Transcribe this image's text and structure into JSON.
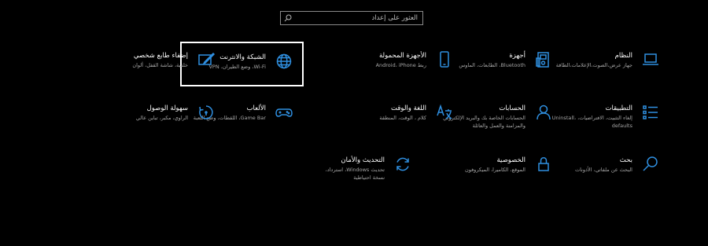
{
  "search": {
    "placeholder": "العثور على إعداد"
  },
  "tiles": [
    {
      "title": "النظام",
      "desc": "جهاز عرض،الصوت،الإعلامات،الطاقة",
      "icon": "laptop-icon"
    },
    {
      "title": "أجهزة",
      "desc": "Bluetooth، الطابعات، الماوس",
      "icon": "devices-icon"
    },
    {
      "title": "الأجهزة المحمولة",
      "desc": "ربط Android، iPhone",
      "icon": "phone-icon"
    },
    {
      "title": "الشبكة والانترنت",
      "desc": "Wi-Fi، وضع الطيران، VPN",
      "icon": "globe-icon"
    },
    {
      "title": "إضفاء طابع شخصي",
      "desc": "خلفية، شاشة القفل، ألوان",
      "icon": "personalization-icon"
    },
    {
      "title": "التطبيقات",
      "desc": "إلغاء التثبيت، الافتراضيات، Uninstall، defaults",
      "icon": "apps-icon"
    },
    {
      "title": "الحسابات",
      "desc": "الحسابات الخاصة بك والبريد الإلكتروني والمزامنة والعمل والعائلة",
      "icon": "person-icon"
    },
    {
      "title": "اللغة والوقت",
      "desc": "كلام ، الوقت، المنطقة",
      "icon": "language-icon"
    },
    {
      "title": "الألعاب",
      "desc": "Game Bar، اللقطات، وضع اللعبة",
      "icon": "gamepad-icon"
    },
    {
      "title": "سهولة الوصول",
      "desc": "الراوي، مكبر، تباين عالي",
      "icon": "ease-of-access-icon"
    },
    {
      "title": "بحث",
      "desc": "البحث عن ملفاتي، الأذونات",
      "icon": "search-settings-icon"
    },
    {
      "title": "الخصوصية",
      "desc": "الموقع، الكاميرا، الميكروفون",
      "icon": "lock-icon"
    },
    {
      "title": "التحديث والأمان",
      "desc": "تحديث Windows، استرداد، نسخة احتياطية",
      "icon": "update-icon"
    }
  ],
  "colors": {
    "accent": "#2f8fe0",
    "background": "#000000",
    "selected_border": "#ffffff"
  }
}
